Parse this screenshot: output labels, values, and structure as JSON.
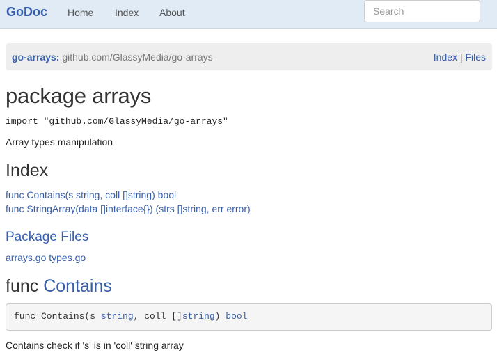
{
  "navbar": {
    "brand": "GoDoc",
    "links": [
      "Home",
      "Index",
      "About"
    ],
    "search_placeholder": "Search"
  },
  "breadcrumb": {
    "package": "go-arrays:",
    "path": "github.com/GlassyMedia/go-arrays",
    "links": [
      "Index",
      "Files"
    ],
    "separator": "|"
  },
  "title": "package arrays",
  "import_line": "import \"github.com/GlassyMedia/go-arrays\"",
  "synopsis": "Array types manipulation",
  "index": {
    "heading": "Index",
    "items": [
      "func Contains(s string, coll []string) bool",
      "func StringArray(data []interface{}) (strs []string, err error)"
    ]
  },
  "package_files": {
    "heading": "Package Files",
    "files": [
      "arrays.go",
      "types.go"
    ]
  },
  "func_contains": {
    "keyword": "func",
    "name": "Contains",
    "signature": {
      "prefix": "func Contains(s ",
      "t1": "string",
      "mid": ", coll []",
      "t2": "string",
      "close": ") ",
      "ret": "bool"
    },
    "description": "Contains check if 's' is in 'coll' string array"
  }
}
